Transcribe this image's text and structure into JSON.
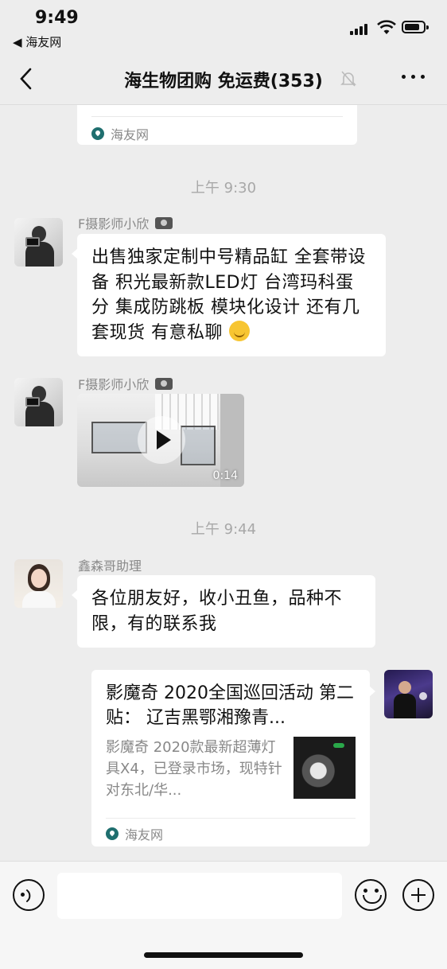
{
  "status": {
    "time": "9:49",
    "back_app": "◀ 海友网"
  },
  "nav": {
    "title": "海生物团购 免运费(353)"
  },
  "top_card": {
    "source": "海友网"
  },
  "messages": {
    "ts1": "上午 9:30",
    "m1_sender": "F摄影师小欣",
    "m1_text": "出售独家定制中号精品缸 全套带设备 积光最新款LED灯 台湾玛科蛋分 集成防跳板 模块化设计 还有几套现货 有意私聊",
    "m2_sender": "F摄影师小欣",
    "m2_duration": "0:14",
    "ts2": "上午 9:44",
    "m3_sender": "鑫森哥助理",
    "m3_text": "各位朋友好，收小丑鱼，品种不限，有的联系我",
    "m4_title": "影魔奇 2020全国巡回活动 第二贴： 辽吉黑鄂湘豫青...",
    "m4_desc": "影魔奇 2020款最新超薄灯具X4，已登录市场，现特针对东北/华...",
    "m4_source": "海友网"
  },
  "colors": {
    "background": "#ededed",
    "bubble": "#ffffff",
    "secondary_text": "#888888",
    "timestamp": "#a8a8a8"
  }
}
